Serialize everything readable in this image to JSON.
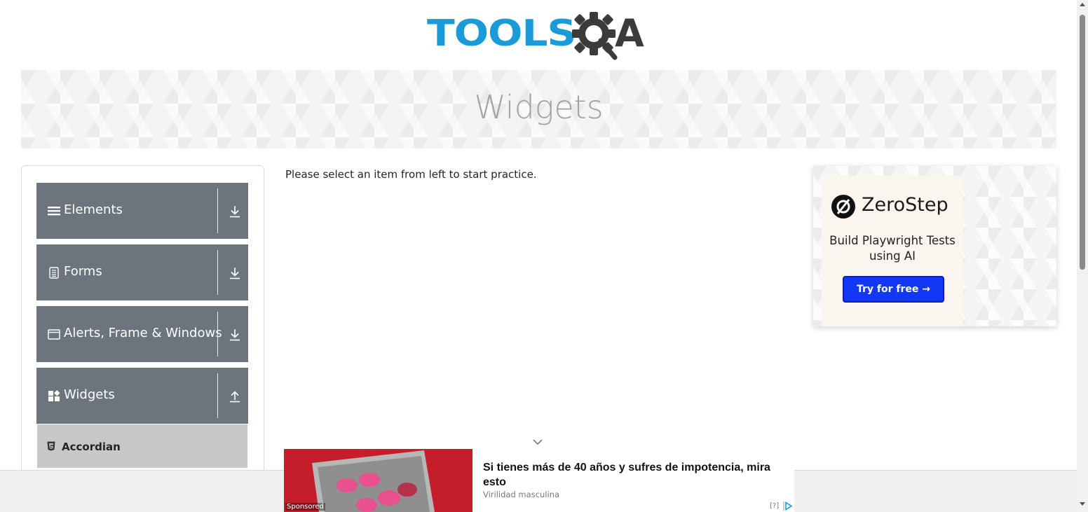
{
  "logo": {
    "tools_text": "TOOLS",
    "a_text": "A",
    "brand_color": "#1a9ad6"
  },
  "banner": {
    "title": "Widgets"
  },
  "sidebar": {
    "groups": [
      {
        "label": "Elements",
        "icon": "hamburger-icon",
        "expanded": false
      },
      {
        "label": "Forms",
        "icon": "document-icon",
        "expanded": false
      },
      {
        "label": "Alerts, Frame & Windows",
        "icon": "window-icon",
        "expanded": false
      },
      {
        "label": "Widgets",
        "icon": "widgets-icon",
        "expanded": true
      }
    ],
    "widget_items": [
      {
        "label": "Accordian",
        "icon": "html5-icon"
      }
    ],
    "group_color": "#6c757d"
  },
  "main": {
    "instruction": "Please select an item from left to start practice."
  },
  "ad": {
    "brand": "ZeroStep",
    "headline": "Build Playwright Tests using AI",
    "cta": "Try for free →",
    "cta_color": "#1338f5"
  },
  "sponsored": {
    "title": "Si tienes más de 40 años y sufres de impotencia, mira esto",
    "source": "Virilidad masculina",
    "tag": "Sponsored",
    "info": "[?]"
  }
}
